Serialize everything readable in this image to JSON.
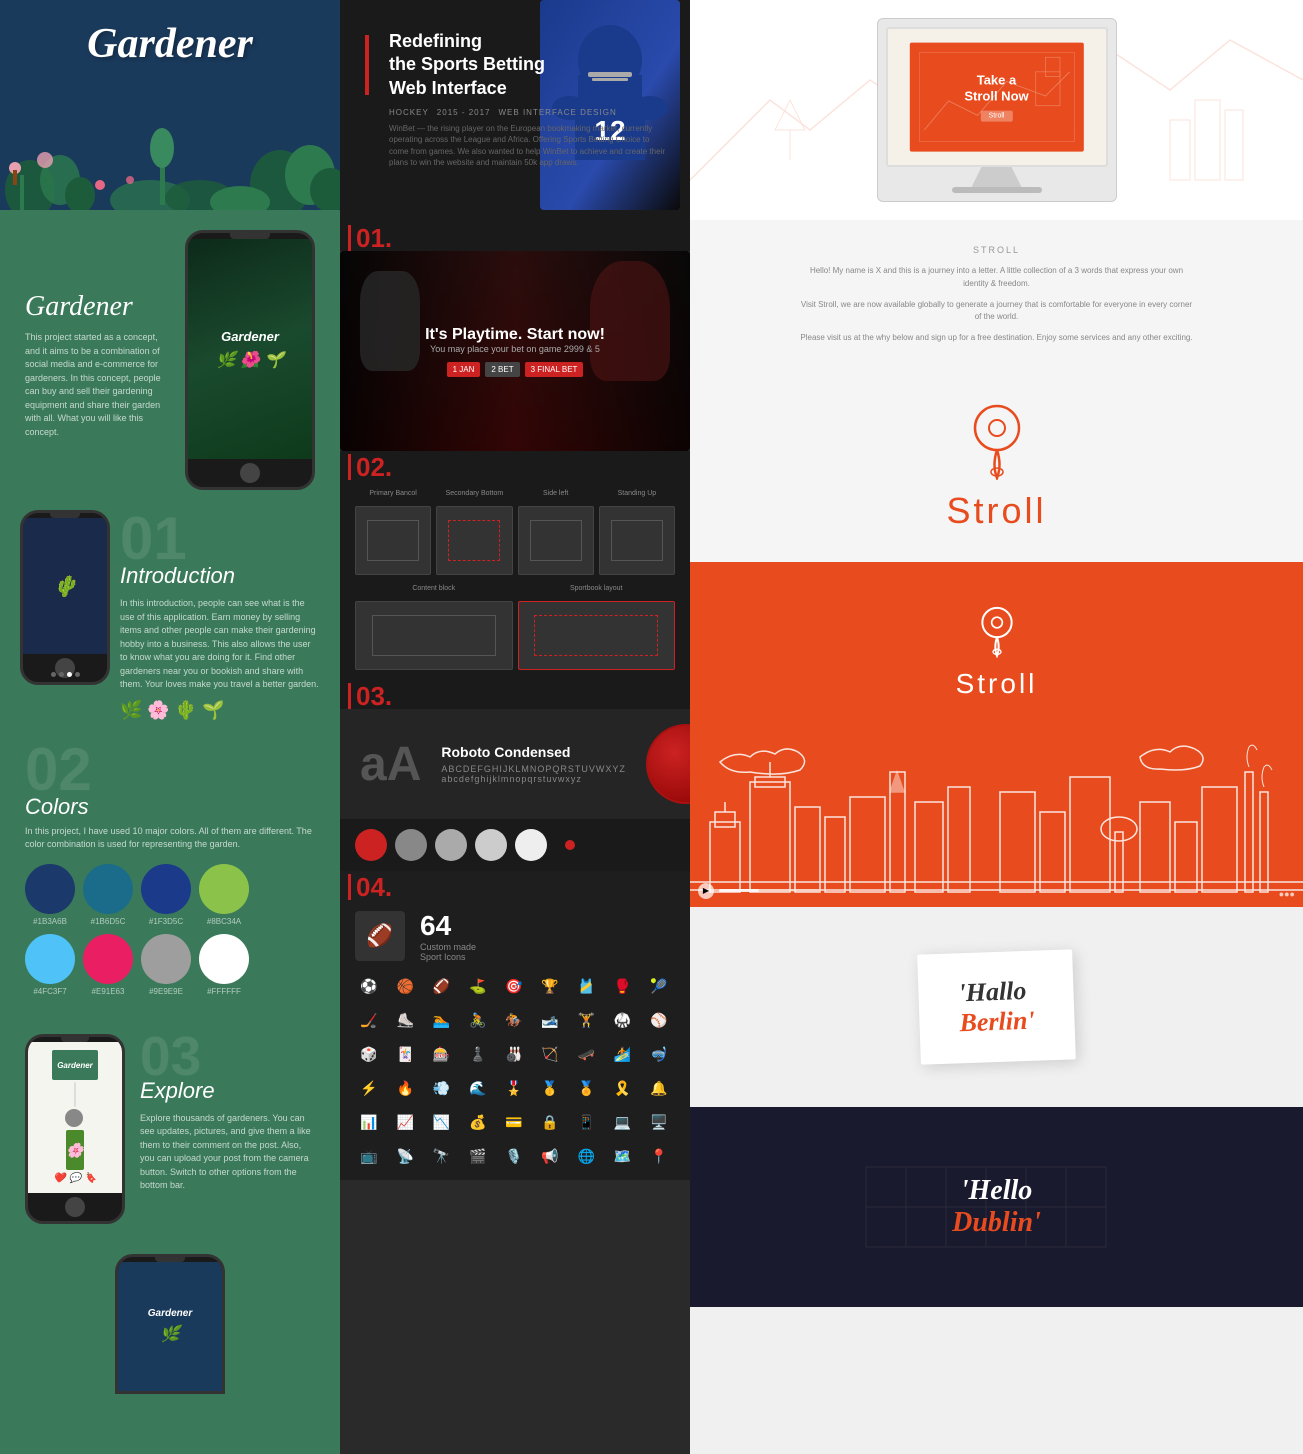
{
  "left": {
    "header_title": "Gardener",
    "app_name": "Gardener",
    "app_desc": "This project started as a concept, and it aims to be a combination of social media and e-commerce for gardeners. In this concept, people can buy and sell their gardening equipment and share their garden with all. What you will like this concept.",
    "section01_number": "01",
    "section01_title": "Introduction",
    "section01_text": "In this introduction, people can see what is the use of this application. Earn money by selling items and other people can make their gardening hobby into a business. This also allows the user to know what you are doing for it. Find other gardeners near you or bookish and share with them. Your loves make you travel a better garden.",
    "section02_number": "02",
    "section02_title": "Colors",
    "colors_text": "In this project, I have used 10 major colors. All of them are different. The color combination is used for representing the garden.",
    "colors": [
      {
        "hex": "#1b3a6b",
        "label": "#1B3A6B"
      },
      {
        "hex": "#1b6b8a",
        "label": "#1B6D5C"
      },
      {
        "hex": "#1b3a8a",
        "label": "#1F3D5C"
      },
      {
        "hex": "#8bc34a",
        "label": "#8BC34A"
      }
    ],
    "colors2": [
      {
        "hex": "#4fc3f7",
        "label": "#4FC3F7"
      },
      {
        "hex": "#e91e63",
        "label": "#E91E63"
      },
      {
        "hex": "#9e9e9e",
        "label": "#9E9E9E"
      },
      {
        "hex": "#ffffff",
        "label": "#FFFFFF"
      }
    ],
    "section03_number": "03",
    "section03_title": "Explore",
    "explore_text": "Explore thousands of gardeners. You can see updates, pictures, and give them a like them to their comment on the post. Also, you can upload your post from the camera button. Switch to other options from the bottom bar."
  },
  "middle": {
    "title_line1": "Redefining",
    "title_line2": "the Sports Betting",
    "title_line3": "Web Interface",
    "tag1": "HOCKEY",
    "tag2": "2015 - 2017",
    "tag3": "WEB INTERFACE DESIGN",
    "desc": "WinBet — the rising player on the European bookmaking market, currently operating across the League and Africa. Offering Sports Betting Choice to come from games. We also wanted to help WinBet to achieve and create their plans to win the website and maintain 50k app draws.",
    "section01_label": "01.",
    "interface_headline": "It's Playtime. Start now!",
    "interface_subtext": "You may place your bet on game 2999 & 5",
    "section02_label": "02.",
    "section03_label": "03.",
    "font_sample": "aA",
    "font_name": "Roboto Condensed",
    "font_chars": "ABCDEFGHIJKLMNOPQRSTUVWXYZ",
    "font_chars_lower": "abcdefghijklmnopqrstuvwxyz",
    "section04_label": "04.",
    "icons_count": "64",
    "icons_label_line1": "Custom made",
    "icons_label_line2": "Sport Icons"
  },
  "right": {
    "stroll_now": "Take a\nStroll Now",
    "letter_title": "Stroll",
    "letter_body1": "Hello! My name is X and this is a journey into a letter. A little collection of a 3 words that express your own identity & freedom.",
    "letter_body2": "Visit Stroll, we are now available globally to generate a journey that is comfortable for everyone in every corner of the world.",
    "letter_body3": "Please visit us at the why below and sign up for a free destination. Enjoy some services and any other exciting.",
    "brand_name": "Stroll",
    "card_brand_name": "Stroll",
    "hello_berlin_hello": "'Hallo",
    "hello_berlin_city": "Berlin'",
    "hello_dublin_hello": "'Hello",
    "hello_dublin_city": "Dublin'"
  }
}
